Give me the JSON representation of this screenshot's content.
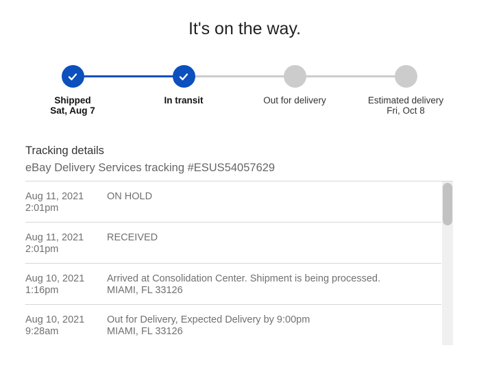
{
  "title": "It's on the way.",
  "progress": {
    "completed_steps": 2,
    "steps": [
      {
        "label": "Shipped",
        "sub": "Sat, Aug 7",
        "status": "done"
      },
      {
        "label": "In transit",
        "sub": "",
        "status": "done"
      },
      {
        "label": "Out for delivery",
        "sub": "",
        "status": "pending"
      },
      {
        "label": "Estimated delivery",
        "sub": "Fri, Oct 8",
        "status": "pending"
      }
    ]
  },
  "tracking": {
    "heading": "Tracking details",
    "carrier_line": "eBay Delivery Services tracking #ESUS54057629",
    "events": [
      {
        "date": "Aug 11, 2021",
        "time": "2:01pm",
        "description": "ON HOLD",
        "location": ""
      },
      {
        "date": "Aug 11, 2021",
        "time": "2:01pm",
        "description": "RECEIVED",
        "location": ""
      },
      {
        "date": "Aug 10, 2021",
        "time": "1:16pm",
        "description": "Arrived at Consolidation Center. Shipment is being processed.",
        "location": "MIAMI, FL 33126"
      },
      {
        "date": "Aug 10, 2021",
        "time": "9:28am",
        "description": "Out for Delivery, Expected Delivery by 9:00pm",
        "location": "MIAMI, FL 33126"
      }
    ]
  },
  "colors": {
    "accent": "#0c4fbd",
    "inactive": "#cccccc",
    "divider": "#d6d6d6"
  },
  "icons": {
    "done_step": "check-icon"
  }
}
